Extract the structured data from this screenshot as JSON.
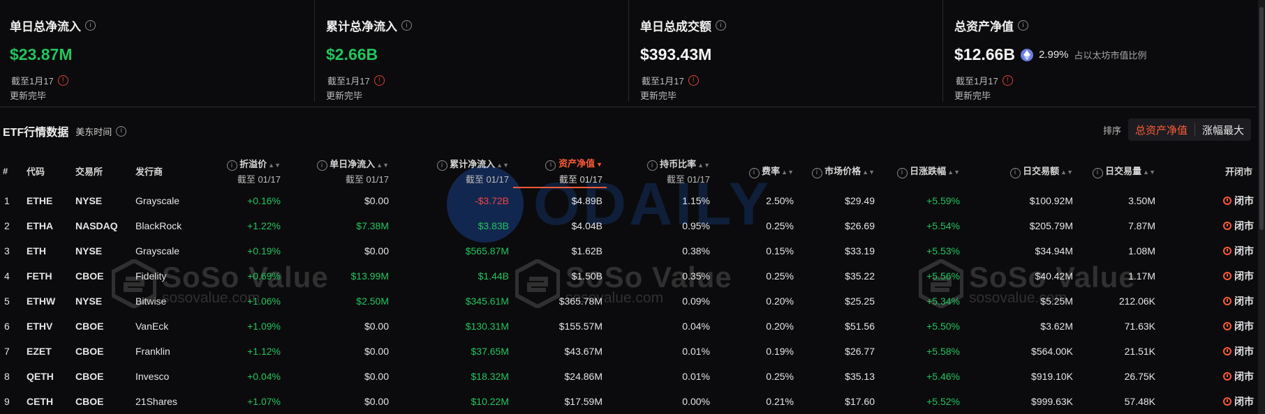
{
  "stats": [
    {
      "title": "单日总净流入",
      "value": "$23.87M",
      "value_color": "green",
      "date": "截至1月17",
      "status": "更新完毕"
    },
    {
      "title": "累计总净流入",
      "value": "$2.66B",
      "value_color": "green",
      "date": "截至1月17",
      "status": "更新完毕"
    },
    {
      "title": "单日总成交额",
      "value": "$393.43M",
      "value_color": "white",
      "date": "截至1月17",
      "status": "更新完毕"
    },
    {
      "title": "总资产净值",
      "value": "$12.66B",
      "value_color": "white",
      "pct": "2.99%",
      "pct_label": "占以太坊市值比例",
      "date": "截至1月17",
      "status": "更新完毕"
    }
  ],
  "section": {
    "title": "ETF行情数据",
    "timezone": "美东时间"
  },
  "sort": {
    "label": "排序",
    "options": [
      "总资产净值",
      "涨幅最大"
    ],
    "active": "总资产净值"
  },
  "columns": {
    "index": "#",
    "code": "代码",
    "exchange": "交易所",
    "issuer": "发行商",
    "premium": "折溢价",
    "premium_sub": "截至 01/17",
    "daily_inflow": "单日净流入",
    "daily_inflow_sub": "截至 01/17",
    "cum_inflow": "累计净流入",
    "cum_inflow_sub": "截至 01/17",
    "nav": "资产净值",
    "nav_sub": "截至 01/17",
    "holding": "持币比率",
    "holding_sub": "截至 01/17",
    "fee": "费率",
    "price": "市场价格",
    "change": "日涨跌幅",
    "turnover": "日交易额",
    "volume": "日交易量",
    "market": "开闭市"
  },
  "rows": [
    {
      "idx": "1",
      "code": "ETHE",
      "exchange": "NYSE",
      "issuer": "Grayscale",
      "premium": "+0.16%",
      "daily_inflow": "$0.00",
      "cum_inflow": "-$3.72B",
      "cum_color": "red",
      "nav": "$4.89B",
      "holding": "1.15%",
      "fee": "2.50%",
      "price": "$29.49",
      "change": "+5.59%",
      "turnover": "$100.92M",
      "volume": "3.50M",
      "market": "闭市"
    },
    {
      "idx": "2",
      "code": "ETHA",
      "exchange": "NASDAQ",
      "issuer": "BlackRock",
      "premium": "+1.22%",
      "daily_inflow": "$7.38M",
      "cum_inflow": "$3.83B",
      "cum_color": "green",
      "nav": "$4.04B",
      "holding": "0.95%",
      "fee": "0.25%",
      "price": "$26.69",
      "change": "+5.54%",
      "turnover": "$205.79M",
      "volume": "7.87M",
      "market": "闭市"
    },
    {
      "idx": "3",
      "code": "ETH",
      "exchange": "NYSE",
      "issuer": "Grayscale",
      "premium": "+0.19%",
      "daily_inflow": "$0.00",
      "cum_inflow": "$565.87M",
      "cum_color": "green",
      "nav": "$1.62B",
      "holding": "0.38%",
      "fee": "0.15%",
      "price": "$33.19",
      "change": "+5.53%",
      "turnover": "$34.94M",
      "volume": "1.08M",
      "market": "闭市"
    },
    {
      "idx": "4",
      "code": "FETH",
      "exchange": "CBOE",
      "issuer": "Fidelity",
      "premium": "+0.69%",
      "daily_inflow": "$13.99M",
      "cum_inflow": "$1.44B",
      "cum_color": "green",
      "nav": "$1.50B",
      "holding": "0.35%",
      "fee": "0.25%",
      "price": "$35.22",
      "change": "+5.56%",
      "turnover": "$40.42M",
      "volume": "1.17M",
      "market": "闭市"
    },
    {
      "idx": "5",
      "code": "ETHW",
      "exchange": "NYSE",
      "issuer": "Bitwise",
      "premium": "+1.06%",
      "daily_inflow": "$2.50M",
      "cum_inflow": "$345.61M",
      "cum_color": "green",
      "nav": "$365.78M",
      "holding": "0.09%",
      "fee": "0.20%",
      "price": "$25.25",
      "change": "+5.34%",
      "turnover": "$5.25M",
      "volume": "212.06K",
      "market": "闭市"
    },
    {
      "idx": "6",
      "code": "ETHV",
      "exchange": "CBOE",
      "issuer": "VanEck",
      "premium": "+1.09%",
      "daily_inflow": "$0.00",
      "cum_inflow": "$130.31M",
      "cum_color": "green",
      "nav": "$155.57M",
      "holding": "0.04%",
      "fee": "0.20%",
      "price": "$51.56",
      "change": "+5.50%",
      "turnover": "$3.62M",
      "volume": "71.63K",
      "market": "闭市"
    },
    {
      "idx": "7",
      "code": "EZET",
      "exchange": "CBOE",
      "issuer": "Franklin",
      "premium": "+1.12%",
      "daily_inflow": "$0.00",
      "cum_inflow": "$37.65M",
      "cum_color": "green",
      "nav": "$43.67M",
      "holding": "0.01%",
      "fee": "0.19%",
      "price": "$26.77",
      "change": "+5.58%",
      "turnover": "$564.00K",
      "volume": "21.51K",
      "market": "闭市"
    },
    {
      "idx": "8",
      "code": "QETH",
      "exchange": "CBOE",
      "issuer": "Invesco",
      "premium": "+0.04%",
      "daily_inflow": "$0.00",
      "cum_inflow": "$18.32M",
      "cum_color": "green",
      "nav": "$24.86M",
      "holding": "0.01%",
      "fee": "0.25%",
      "price": "$35.13",
      "change": "+5.46%",
      "turnover": "$919.10K",
      "volume": "26.75K",
      "market": "闭市"
    },
    {
      "idx": "9",
      "code": "CETH",
      "exchange": "CBOE",
      "issuer": "21Shares",
      "premium": "+1.07%",
      "daily_inflow": "$0.00",
      "cum_inflow": "$10.22M",
      "cum_color": "green",
      "nav": "$17.59M",
      "holding": "0.00%",
      "fee": "0.21%",
      "price": "$17.60",
      "change": "+5.52%",
      "turnover": "$999.63K",
      "volume": "57.48K",
      "market": "闭市"
    }
  ],
  "watermarks": {
    "soso_brand": "SoSo Value",
    "soso_url": "sosovalue.com",
    "odaily": "ODAILY"
  },
  "icons": {
    "info": "info-icon",
    "eth": "ethereum-icon",
    "clock": "clock-icon",
    "sort": "sort-caret-icon"
  },
  "colors": {
    "green": "#22c55e",
    "red": "#ef4444",
    "accent": "#ff5a36"
  }
}
